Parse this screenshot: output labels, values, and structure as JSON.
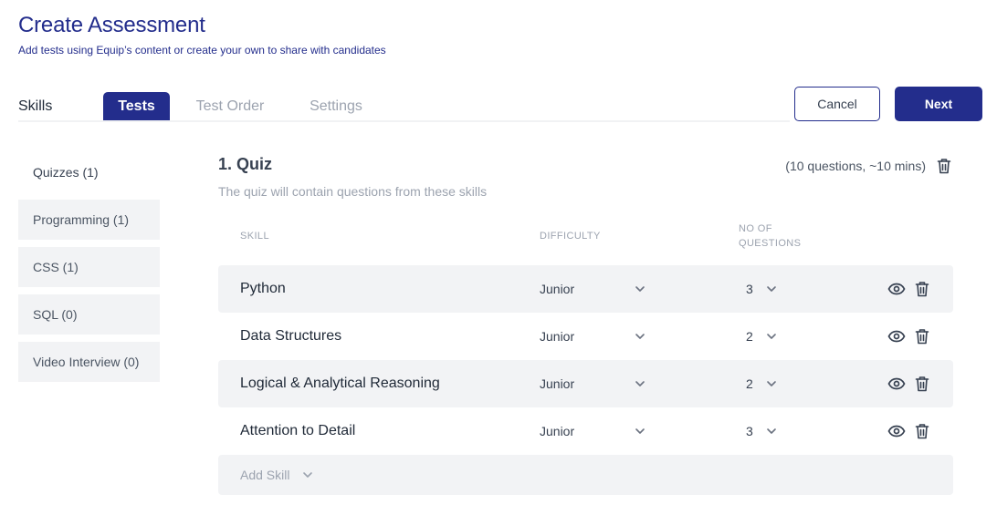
{
  "header": {
    "title": "Create Assessment",
    "subtitle": "Add tests using Equip’s content or create your own to share with candidates"
  },
  "tabs": [
    {
      "label": "Skills",
      "active": false
    },
    {
      "label": "Tests",
      "active": true
    },
    {
      "label": "Test Order",
      "active": false
    },
    {
      "label": "Settings",
      "active": false
    }
  ],
  "actions": {
    "cancel_label": "Cancel",
    "next_label": "Next"
  },
  "sidebar": {
    "items": [
      {
        "label": "Quizzes (1)",
        "active": true
      },
      {
        "label": "Programming (1)",
        "active": false
      },
      {
        "label": "CSS (1)",
        "active": false
      },
      {
        "label": "SQL (0)",
        "active": false
      },
      {
        "label": "Video Interview (0)",
        "active": false
      }
    ]
  },
  "quiz": {
    "title": "1. Quiz",
    "meta": "(10 questions, ~10 mins)",
    "description": "The quiz will contain questions from these skills",
    "columns": {
      "skill": "SKILL",
      "difficulty": "DIFFICULTY",
      "no_of_questions": "NO OF QUESTIONS"
    },
    "rows": [
      {
        "skill": "Python",
        "difficulty": "Junior",
        "questions": "3"
      },
      {
        "skill": "Data Structures",
        "difficulty": "Junior",
        "questions": "2"
      },
      {
        "skill": "Logical & Analytical Reasoning",
        "difficulty": "Junior",
        "questions": "2"
      },
      {
        "skill": "Attention to Detail",
        "difficulty": "Junior",
        "questions": "3"
      }
    ],
    "add_skill_placeholder": "Add Skill"
  },
  "icons": {
    "view": "eye-icon",
    "delete": "trash-icon",
    "dropdown": "chevron-down-icon"
  },
  "colors": {
    "brand": "#232d8c",
    "row_shade": "#f2f3f5",
    "muted_text": "#9ca3af"
  }
}
